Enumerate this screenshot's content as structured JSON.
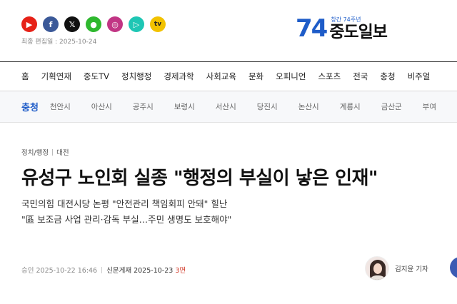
{
  "header": {
    "social": [
      {
        "name": "youtube-icon",
        "glyph": "▶",
        "color": "#e62117"
      },
      {
        "name": "facebook-icon",
        "glyph": "f",
        "color": "#3b5998"
      },
      {
        "name": "x-icon",
        "glyph": "𝕏",
        "color": "#111111"
      },
      {
        "name": "talk-icon",
        "glyph": "●",
        "color": "#2eb82e"
      },
      {
        "name": "instagram-icon",
        "glyph": "◎",
        "color": "#c13584"
      },
      {
        "name": "play-icon",
        "glyph": "▷",
        "color": "#1ec6b4"
      },
      {
        "name": "tv-icon",
        "glyph": "tv",
        "color": "#f2c200"
      }
    ],
    "updated": "최종 편집일 : 2025-10-24",
    "logo_number": "74",
    "logo_small": "창간 74주년",
    "logo_name": "중도일보"
  },
  "nav": {
    "items": [
      "홈",
      "기획연재",
      "중도TV",
      "정치행정",
      "경제과학",
      "사회교육",
      "문화",
      "오피니언",
      "스포츠",
      "전국",
      "충청",
      "비주얼"
    ]
  },
  "subnav": {
    "title": "충청",
    "items": [
      "천안시",
      "아산시",
      "공주시",
      "보령시",
      "서산시",
      "당진시",
      "논산시",
      "계룡시",
      "금산군",
      "부여"
    ]
  },
  "article": {
    "crumb_section": "정치/행정",
    "crumb_region": "대전",
    "headline": "유성구 노인회 실종 \"행정의 부실이 낳은 인재\"",
    "subhead_1": "국민의힘 대전시당 논평 \"안전관리 책임회피 안돼\" 힐난",
    "subhead_2": "\"區 보조금 사업 관리·감독 부실…주민 생명도 보호해야\"",
    "approved": "승인 2025-10-22 16:46",
    "print_label": "신문게재 2025-10-23",
    "print_page": "3면",
    "reporter": "김지윤 기자"
  },
  "colors": {
    "brand_blue": "#1e5cc8",
    "page_red": "#d23b2a"
  }
}
